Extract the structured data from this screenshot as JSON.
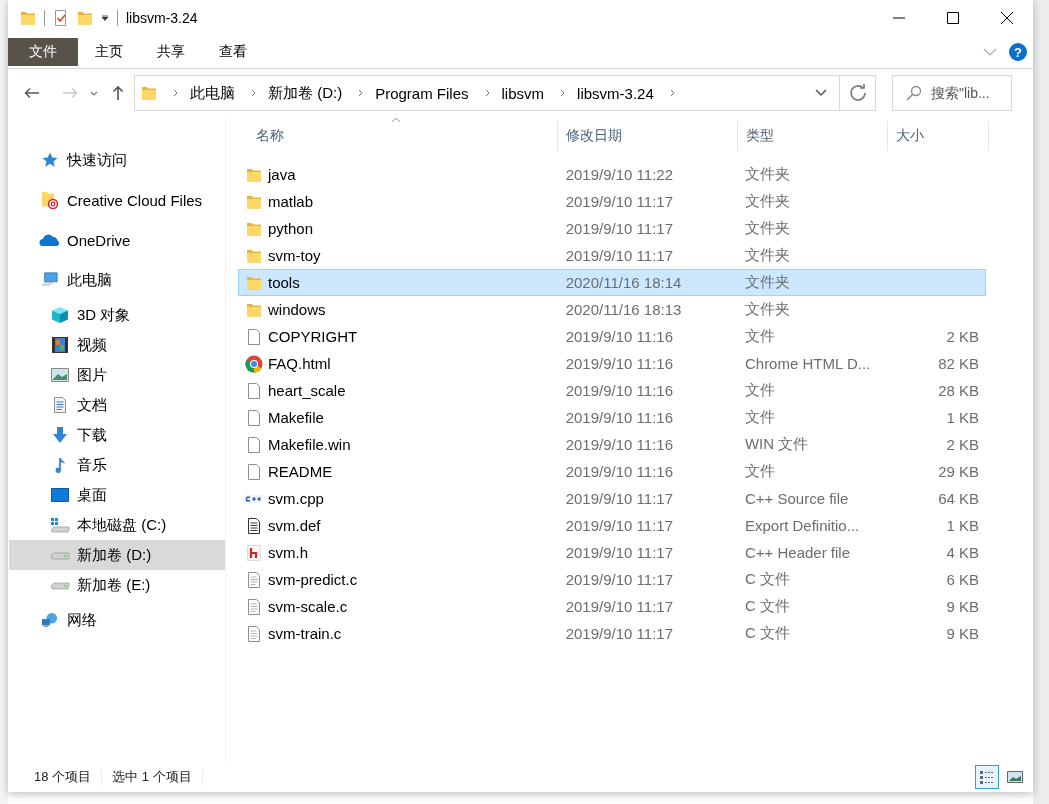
{
  "window": {
    "title": "libsvm-3.24",
    "help_button": "?"
  },
  "ribbon": {
    "tabs": [
      {
        "label": "文件",
        "kind": "file",
        "selected": false
      },
      {
        "label": "主页",
        "kind": "tab",
        "selected": false
      },
      {
        "label": "共享",
        "kind": "tab",
        "selected": false
      },
      {
        "label": "查看",
        "kind": "tab",
        "selected": false
      }
    ]
  },
  "navigation": {
    "back": {
      "disabled": false
    },
    "forward": {
      "disabled": true
    },
    "up": {
      "disabled": false
    }
  },
  "address": {
    "crumbs": [
      "此电脑",
      "新加卷 (D:)",
      "Program Files",
      "libsvm",
      "libsvm-3.24"
    ]
  },
  "search": {
    "placeholder": "搜索\"lib..."
  },
  "sidebar": {
    "items": [
      {
        "label": "快速访问",
        "kind": "star",
        "selected": false
      },
      {
        "label": "Creative Cloud Files",
        "kind": "cc-folder",
        "selected": false
      },
      {
        "label": "OneDrive",
        "kind": "cloud",
        "selected": false
      },
      {
        "label": "此电脑",
        "kind": "pc",
        "selected": false,
        "children": [
          {
            "label": "3D 对象",
            "kind": "cube",
            "selected": false
          },
          {
            "label": "视频",
            "kind": "film",
            "selected": false
          },
          {
            "label": "图片",
            "kind": "image",
            "selected": false
          },
          {
            "label": "文档",
            "kind": "document",
            "selected": false
          },
          {
            "label": "下载",
            "kind": "download",
            "selected": false
          },
          {
            "label": "音乐",
            "kind": "music",
            "selected": false
          },
          {
            "label": "桌面",
            "kind": "desktop",
            "selected": false
          },
          {
            "label": "本地磁盘 (C:)",
            "kind": "system-drive",
            "selected": false
          },
          {
            "label": "新加卷 (D:)",
            "kind": "drive",
            "selected": true
          },
          {
            "label": "新加卷 (E:)",
            "kind": "drive",
            "selected": false
          }
        ]
      },
      {
        "label": "网络",
        "kind": "network",
        "selected": false
      }
    ]
  },
  "table": {
    "columns": [
      {
        "label": "名称",
        "sorted": true
      },
      {
        "label": "修改日期",
        "sorted": false
      },
      {
        "label": "类型",
        "sorted": false
      },
      {
        "label": "大小",
        "sorted": false
      }
    ],
    "rows": [
      {
        "name": "java",
        "modified": "2019/9/10 11:22",
        "type": "文件夹",
        "kind": "folder",
        "selected": false
      },
      {
        "name": "matlab",
        "modified": "2019/9/10 11:17",
        "type": "文件夹",
        "kind": "folder",
        "selected": false
      },
      {
        "name": "python",
        "modified": "2019/9/10 11:17",
        "type": "文件夹",
        "kind": "folder",
        "selected": false
      },
      {
        "name": "svm-toy",
        "modified": "2019/9/10 11:17",
        "type": "文件夹",
        "kind": "folder",
        "selected": false
      },
      {
        "name": "tools",
        "modified": "2020/11/16 18:14",
        "type": "文件夹",
        "kind": "folder",
        "selected": true
      },
      {
        "name": "windows",
        "modified": "2020/11/16 18:13",
        "type": "文件夹",
        "kind": "folder",
        "selected": false
      },
      {
        "name": "COPYRIGHT",
        "modified": "2019/9/10 11:16",
        "type": "文件",
        "size": "2 KB",
        "kind": "blank",
        "selected": false
      },
      {
        "name": "FAQ.html",
        "modified": "2019/9/10 11:16",
        "type": "Chrome HTML D...",
        "size": "82 KB",
        "kind": "chrome",
        "selected": false
      },
      {
        "name": "heart_scale",
        "modified": "2019/9/10 11:16",
        "type": "文件",
        "size": "28 KB",
        "kind": "blank",
        "selected": false
      },
      {
        "name": "Makefile",
        "modified": "2019/9/10 11:16",
        "type": "文件",
        "size": "1 KB",
        "kind": "blank",
        "selected": false
      },
      {
        "name": "Makefile.win",
        "modified": "2019/9/10 11:16",
        "type": "WIN 文件",
        "size": "2 KB",
        "kind": "blank",
        "selected": false
      },
      {
        "name": "README",
        "modified": "2019/9/10 11:16",
        "type": "文件",
        "size": "29 KB",
        "kind": "blank",
        "selected": false
      },
      {
        "name": "svm.cpp",
        "modified": "2019/9/10 11:17",
        "type": "C++ Source file",
        "size": "64 KB",
        "kind": "cpp",
        "selected": false
      },
      {
        "name": "svm.def",
        "modified": "2019/9/10 11:17",
        "type": "Export Definitio...",
        "size": "1 KB",
        "kind": "def",
        "selected": false
      },
      {
        "name": "svm.h",
        "modified": "2019/9/10 11:17",
        "type": "C++ Header file",
        "size": "4 KB",
        "kind": "header",
        "selected": false
      },
      {
        "name": "svm-predict.c",
        "modified": "2019/9/10 11:17",
        "type": "C 文件",
        "size": "6 KB",
        "kind": "source",
        "selected": false
      },
      {
        "name": "svm-scale.c",
        "modified": "2019/9/10 11:17",
        "type": "C 文件",
        "size": "9 KB",
        "kind": "source",
        "selected": false
      },
      {
        "name": "svm-train.c",
        "modified": "2019/9/10 11:17",
        "type": "C 文件",
        "size": "9 KB",
        "kind": "source",
        "selected": false
      }
    ]
  },
  "status_bar": {
    "item_count": "18 个项目",
    "selection": "选中 1 个项目",
    "views": [
      {
        "kind": "details",
        "selected": true
      },
      {
        "kind": "thumbnails",
        "selected": false
      }
    ]
  }
}
